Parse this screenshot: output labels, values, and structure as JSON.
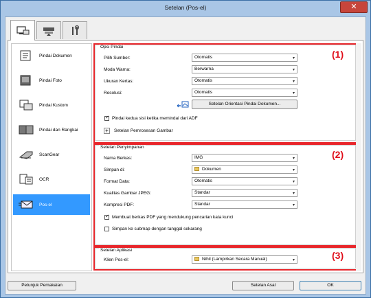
{
  "window": {
    "title": "Setelan (Pos-el)",
    "close_glyph": "✕"
  },
  "tabs": [
    {
      "icon": "scanner-computer-icon"
    },
    {
      "icon": "scanner-icon"
    },
    {
      "icon": "tools-icon"
    }
  ],
  "sidebar": {
    "items": [
      {
        "label": "Pindai Dokumen",
        "icon": "document-scan-icon"
      },
      {
        "label": "Pindai Foto",
        "icon": "photo-scan-icon"
      },
      {
        "label": "Pindai Kustom",
        "icon": "custom-scan-icon"
      },
      {
        "label": "Pindai dan Rangkai",
        "icon": "stitch-scan-icon"
      },
      {
        "label": "ScanGear",
        "icon": "scangear-icon"
      },
      {
        "label": "OCR",
        "icon": "ocr-icon"
      },
      {
        "label": "Pos-el",
        "icon": "email-icon",
        "selected": true
      }
    ]
  },
  "markers": {
    "m1": "(1)",
    "m2": "(2)",
    "m3": "(3)"
  },
  "scan_options": {
    "title": "Opsi Pindai",
    "source_label": "Pilih Sumber:",
    "source_value": "Otomatis",
    "color_label": "Moda Warna:",
    "color_value": "Berwarna",
    "size_label": "Ukuran Kertas:",
    "size_value": "Otomatis",
    "res_label": "Resolusi:",
    "res_value": "Otomatis",
    "orientation_button": "Setelan Orientasi Pindai Dokumen...",
    "duplex_label": "Pindai kedua sisi ketika memindai dari ADF",
    "image_processing_label": "Setelan Pemrosesan Gambar"
  },
  "save_settings": {
    "title": "Setelan Penyimpanan",
    "filename_label": "Nama Berkas:",
    "filename_value": "IMG",
    "savein_label": "Simpan di:",
    "savein_value": "Dokumen",
    "format_label": "Format Data:",
    "format_value": "Otomatis",
    "jpeg_label": "Kualitas Gambar JPEG:",
    "jpeg_value": "Standar",
    "pdf_label": "Kompresi PDF:",
    "pdf_value": "Standar",
    "keyword_pdf_label": "Membuat berkas PDF yang mendukung pencarian kata kunci",
    "subfolder_label": "Simpan ke submap dengan tanggal sekarang"
  },
  "app_settings": {
    "title": "Setelan Aplikasi",
    "client_label": "Klien Pos-el:",
    "client_value": "Nihil (Lampirkan Secara Manual)"
  },
  "footer": {
    "help_button": "Petunjuk Pemakaian",
    "defaults_button": "Setelan Asal",
    "ok_button": "OK"
  },
  "colors": {
    "highlight": "#e8262b",
    "selection": "#3399ff"
  }
}
